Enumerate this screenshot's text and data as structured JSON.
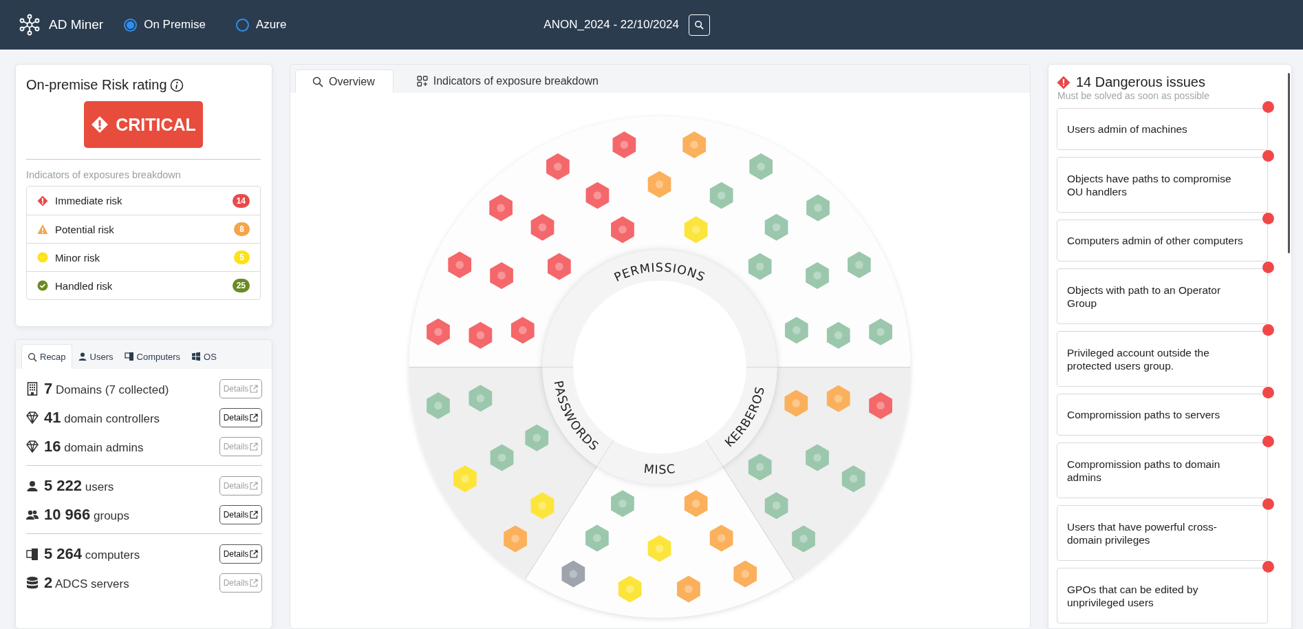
{
  "header": {
    "app_name": "AD Miner",
    "modes": [
      {
        "label": "On Premise",
        "selected": true
      },
      {
        "label": "Azure",
        "selected": false
      }
    ],
    "report": "ANON_2024 - 22/10/2024"
  },
  "risk_card": {
    "title": "On-premise Risk rating",
    "rating": {
      "kind": "critical",
      "label": "CRITICAL"
    },
    "breakdown_title": "Indicators of exposures breakdown",
    "levels": [
      {
        "kind": "immediate",
        "label": "Immediate risk",
        "count": "14"
      },
      {
        "kind": "potential",
        "label": "Potential risk",
        "count": "8"
      },
      {
        "kind": "minor",
        "label": "Minor risk",
        "count": "5"
      },
      {
        "kind": "handled",
        "label": "Handled risk",
        "count": "25"
      }
    ]
  },
  "recap": {
    "tabs": [
      {
        "kind": "recap",
        "label": "Recap",
        "selected": true
      },
      {
        "kind": "users",
        "label": "Users",
        "selected": false
      },
      {
        "kind": "computers",
        "label": "Computers",
        "selected": false
      },
      {
        "kind": "os",
        "label": "OS",
        "selected": false
      }
    ],
    "sections": [
      {
        "items": [
          {
            "kind": "domains",
            "count": "7",
            "label": "Domains (7 collected)",
            "button": "Details",
            "disabled": true
          },
          {
            "kind": "controllers",
            "count": "41",
            "label": "domain controllers",
            "button": "Details",
            "disabled": false
          },
          {
            "kind": "admins",
            "count": "16",
            "label": "domain admins",
            "button": "Details",
            "disabled": true
          }
        ]
      },
      {
        "items": [
          {
            "kind": "users",
            "count": "5 222",
            "label": "users",
            "button": "Details",
            "disabled": true
          },
          {
            "kind": "groups",
            "count": "10 966",
            "label": "groups",
            "button": "Details",
            "disabled": false
          }
        ]
      },
      {
        "items": [
          {
            "kind": "computers",
            "count": "5 264",
            "label": "computers",
            "button": "Details",
            "disabled": false
          },
          {
            "kind": "adcs",
            "count": "2",
            "label": "ADCS servers",
            "button": "Details",
            "disabled": true
          }
        ]
      }
    ]
  },
  "overview": {
    "tabs": [
      {
        "kind": "overview",
        "label": "Overview",
        "selected": true
      },
      {
        "kind": "breakdown",
        "label": "Indicators of exposure breakdown",
        "selected": false
      }
    ],
    "chart": {
      "sections": [
        {
          "label": "PERMISSIONS",
          "indicators": [
            {
              "kind": "immediate"
            },
            {
              "kind": "potential"
            },
            {
              "kind": "immediate"
            },
            {
              "kind": "handled"
            },
            {
              "kind": "potential"
            },
            {
              "kind": "immediate"
            },
            {
              "kind": "handled"
            },
            {
              "kind": "immediate"
            },
            {
              "kind": "handled"
            },
            {
              "kind": "immediate"
            },
            {
              "kind": "immediate"
            },
            {
              "kind": "minor"
            },
            {
              "kind": "handled"
            },
            {
              "kind": "immediate"
            },
            {
              "kind": "immediate"
            },
            {
              "kind": "immediate"
            },
            {
              "kind": "handled"
            },
            {
              "kind": "handled"
            },
            {
              "kind": "handled"
            },
            {
              "kind": "immediate"
            },
            {
              "kind": "immediate"
            },
            {
              "kind": "immediate"
            },
            {
              "kind": "handled"
            },
            {
              "kind": "handled"
            },
            {
              "kind": "handled"
            }
          ]
        },
        {
          "label": "PASSWORDS",
          "indicators": [
            {
              "kind": "handled"
            },
            {
              "kind": "handled"
            },
            {
              "kind": "handled"
            },
            {
              "kind": "handled"
            },
            {
              "kind": "minor"
            },
            {
              "kind": "minor"
            },
            {
              "kind": "potential"
            }
          ]
        },
        {
          "label": "MISC",
          "indicators": [
            {
              "kind": "handled"
            },
            {
              "kind": "potential"
            },
            {
              "kind": "handled"
            },
            {
              "kind": "minor"
            },
            {
              "kind": "potential"
            },
            {
              "kind": "none"
            },
            {
              "kind": "minor"
            },
            {
              "kind": "potential"
            },
            {
              "kind": "potential"
            }
          ]
        },
        {
          "label": "KERBEROS",
          "indicators": [
            {
              "kind": "potential"
            },
            {
              "kind": "potential"
            },
            {
              "kind": "immediate"
            },
            {
              "kind": "handled"
            },
            {
              "kind": "handled"
            },
            {
              "kind": "handled"
            },
            {
              "kind": "handled"
            },
            {
              "kind": "handled"
            }
          ]
        }
      ]
    }
  },
  "issues": {
    "title": "14 Dangerous issues",
    "subtitle": "Must be solved as soon as possible",
    "items": [
      "Users admin of machines",
      "Objects have paths to compromise OU handlers",
      "Computers admin of other computers",
      "Objects with path to an Operator Group",
      "Privileged account outside the protected users group.",
      "Compromission paths to servers",
      "Compromission paths to domain admins",
      "Users that have powerful cross-domain privileges",
      "GPOs that can be edited by unprivileged users"
    ]
  }
}
